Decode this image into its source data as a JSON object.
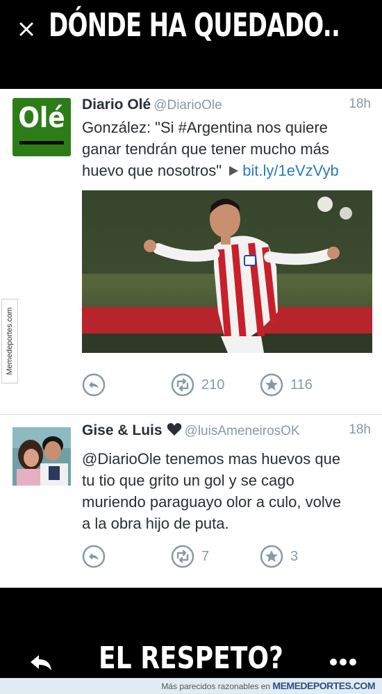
{
  "meme": {
    "top_text": "DÓNDE HA QUEDADO..",
    "bottom_text": "EL RESPETO?"
  },
  "watermark": "Memedeportes.com",
  "tweets": [
    {
      "author_name": "Diario Olé",
      "author_handle": "@DiarioOle",
      "avatar_text": "Olé",
      "time": "18h",
      "text_line1": "González:  \"Si #Argentina nos quiere",
      "text_line2": "ganar tendrán que tener mucho más",
      "text_line3": "huevo que nosotros\"",
      "link": "bit.ly/1eVzVyb",
      "retweets": "210",
      "favorites": "116"
    },
    {
      "author_name": "Gise & Luis",
      "author_handle": "@luisAmeneirosOK",
      "time": "18h",
      "text_line1": "@DiarioOle tenemos mas huevos que",
      "text_line2": "tu tio que grito un gol y se cago",
      "text_line3": "muriendo paraguayo olor a culo, volve",
      "text_line4": "a la obra hijo de puta.",
      "retweets": "7",
      "favorites": "3"
    }
  ],
  "footer": {
    "text": "Más parecidos razonables en",
    "brand": "MEMEDEPORTES.COM"
  },
  "colors": {
    "link": "#2b7bb9",
    "muted": "#8899a6",
    "ole_green": "#2c7d18"
  },
  "icons": [
    "close-icon",
    "reply-icon",
    "retweet-icon",
    "favorite-star-icon",
    "heart-icon",
    "play-icon",
    "back-arrow-icon",
    "more-icon"
  ]
}
